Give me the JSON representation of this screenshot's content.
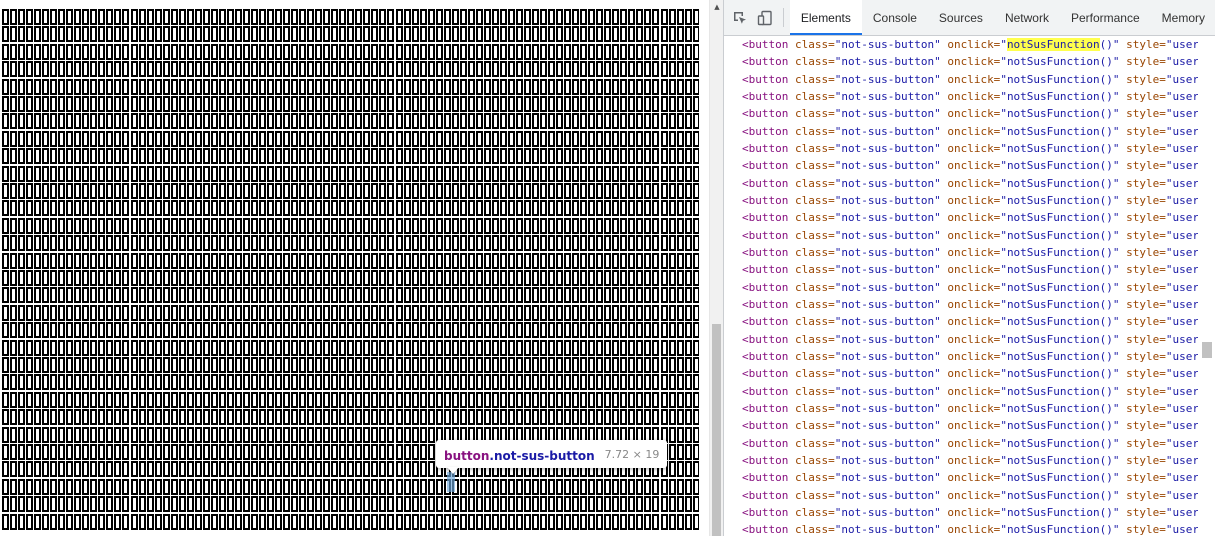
{
  "tooltip": {
    "tag": "button",
    "class_name": ".not-sus-button",
    "dimensions": "7.72 × 19"
  },
  "devtools": {
    "tabs": [
      {
        "label": "Elements",
        "active": true
      },
      {
        "label": "Console",
        "active": false
      },
      {
        "label": "Sources",
        "active": false
      },
      {
        "label": "Network",
        "active": false
      },
      {
        "label": "Performance",
        "active": false
      },
      {
        "label": "Memory",
        "active": false
      }
    ],
    "icons": [
      "inspect-element-icon",
      "device-toolbar-icon"
    ],
    "dom_line": {
      "tag_open": "<button",
      "class_attr": "class=",
      "class_value": "\"not-sus-button\"",
      "onclick_attr": "onclick=",
      "onclick_value": "notSusFunction",
      "onclick_suffix": "()\"",
      "style_attr": "style=",
      "style_value": "\"user"
    },
    "highlighted_line_index": 0,
    "line_count": 29
  },
  "page": {
    "button_columns": 87,
    "button_rows": 30
  },
  "colors": {
    "tag": "#881280",
    "attr_name": "#994500",
    "attr_value": "#1a1aa6",
    "search_highlight": "#ffff4d",
    "active_tab_underline": "#1a73e8"
  }
}
